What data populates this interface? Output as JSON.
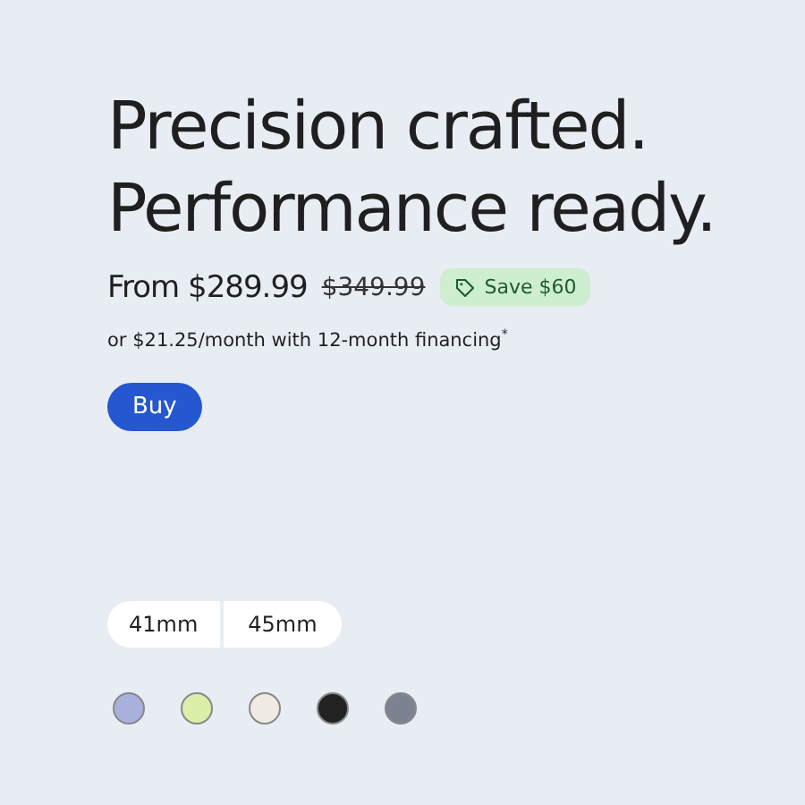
{
  "headline": [
    "Precision crafted.",
    "Performance ready."
  ],
  "price": {
    "current": "From $289.99",
    "original": "$349.99",
    "savings": "Save $60"
  },
  "financing": "or $21.25/month with 12-month financing$^{*}$",
  "buy_button": "Buy",
  "sizes": [
    {
      "label": "41mm"
    },
    {
      "label": "45mm"
    }
  ],
  "colors": [
    {
      "color": "#aab0dc"
    },
    {
      "color": "#dcefa8"
    },
    {
      "color": "#efebe3"
    },
    {
      "color": "#222222"
    },
    {
      "color": "#7d8290"
    }
  ]
}
